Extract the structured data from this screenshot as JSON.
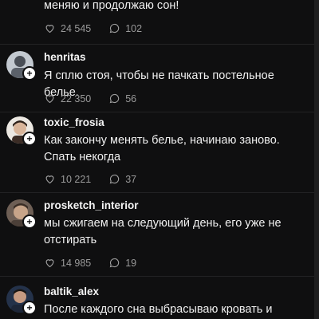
{
  "partial_comment": {
    "text": "меняю и продолжаю сон!",
    "likes": "24 545",
    "replies": "102"
  },
  "comments": [
    {
      "username": "henritas",
      "text": "Я сплю стоя, чтобы не пачкать постельное белье.",
      "likes": "22 350",
      "replies": "56",
      "avatar_colors": [
        "#b9bfc7",
        "#e9ecef"
      ]
    },
    {
      "username": "toxic_frosia",
      "text": "Как закончу менять белье, начинаю заново. Спать некогда",
      "likes": "10 221",
      "replies": "37",
      "avatar_colors": [
        "#e8e4de",
        "#3b2c25"
      ]
    },
    {
      "username": "prosketch_interior",
      "text": "мы сжигаем на следующий день, его уже не отстирать",
      "likes": "14 985",
      "replies": "19",
      "avatar_colors": [
        "#7b6a5e",
        "#c9a88c"
      ]
    },
    {
      "username": "baltik_alex",
      "text": "После каждого сна выбрасываю кровать и",
      "avatar_colors": [
        "#2b3a55",
        "#c79b82"
      ]
    }
  ],
  "icons": {
    "like": "heart-outline-icon",
    "reply": "speech-bubble-icon",
    "follow": "plus-icon"
  }
}
